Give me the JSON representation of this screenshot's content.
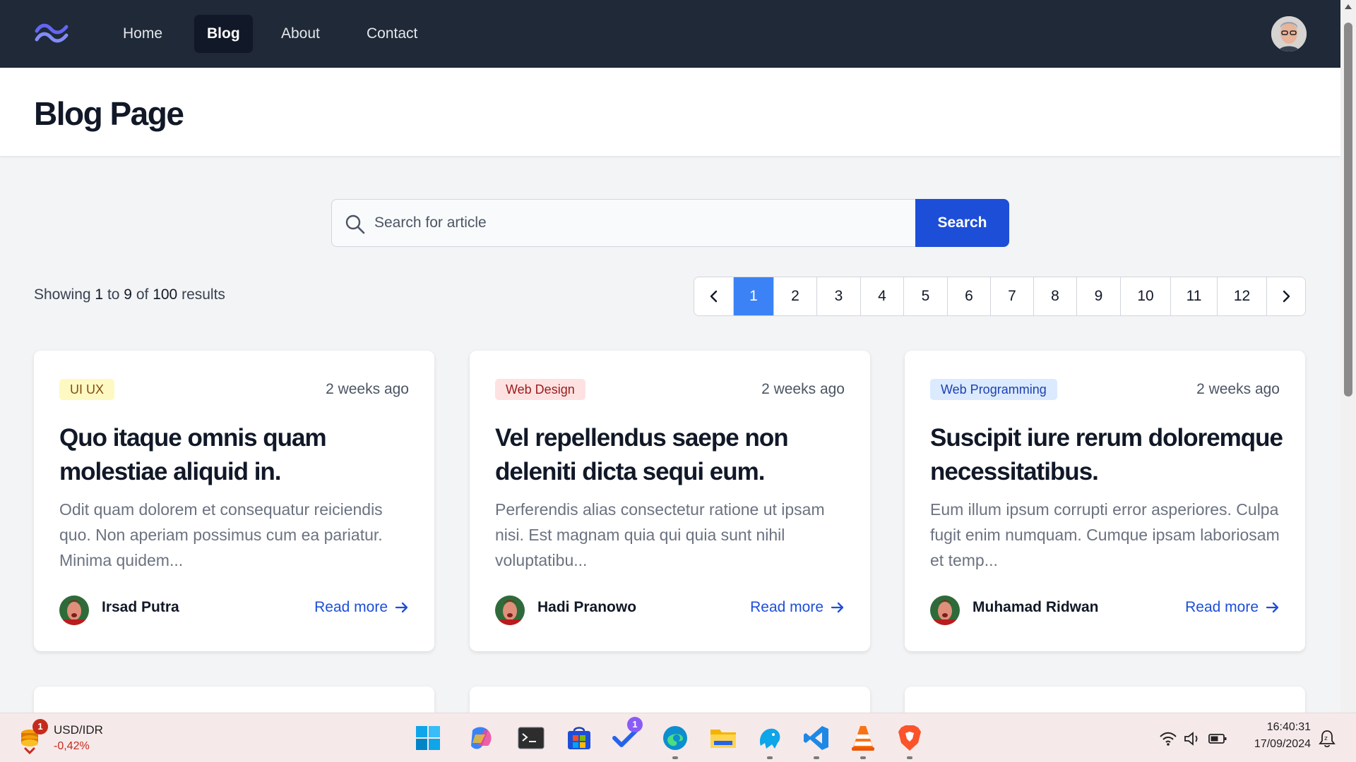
{
  "nav": {
    "items": [
      {
        "label": "Home"
      },
      {
        "label": "Blog"
      },
      {
        "label": "About"
      },
      {
        "label": "Contact"
      }
    ],
    "active_item": "Blog",
    "brand_color": "#1f2937"
  },
  "header": {
    "title": "Blog Page"
  },
  "search": {
    "placeholder": "Search for article",
    "value": "",
    "button_label": "Search",
    "button_color": "#1d4ed8"
  },
  "results": {
    "prefix": "Showing",
    "from": "1",
    "to_word": "to",
    "to": "9",
    "of_word": "of",
    "total": "100",
    "suffix": "results"
  },
  "pagination": {
    "prev_icon": "chevron-left-icon",
    "next_icon": "chevron-right-icon",
    "pages": [
      "1",
      "2",
      "3",
      "4",
      "5",
      "6",
      "7",
      "8",
      "9",
      "10",
      "11",
      "12"
    ],
    "current": "1",
    "active_color": "#3b82f6"
  },
  "cards": [
    {
      "category": "UI UX",
      "category_color": "yellow",
      "date": "2 weeks ago",
      "title": "Quo itaque omnis quam molestiae aliquid in.",
      "excerpt": "Odit quam dolorem et consequatur reiciendis quo. Non aperiam possimus cum ea pariatur. Minima quidem...",
      "author": "Irsad Putra",
      "read_more": "Read more"
    },
    {
      "category": "Web Design",
      "category_color": "red",
      "date": "2 weeks ago",
      "title": "Vel repellendus saepe non deleniti dicta sequi eum.",
      "excerpt": "Perferendis alias consectetur ratione ut ipsam nisi. Est magnam quia qui quia sunt nihil voluptatibu...",
      "author": "Hadi Pranowo",
      "read_more": "Read more"
    },
    {
      "category": "Web Programming",
      "category_color": "blue",
      "date": "2 weeks ago",
      "title": "Suscipit iure rerum doloremque necessitatibus.",
      "excerpt": "Eum illum ipsum corrupti error asperiores. Culpa fugit enim numquam. Cumque ipsam laboriosam et temp...",
      "author": "Muhamad Ridwan",
      "read_more": "Read more"
    }
  ],
  "taskbar": {
    "widget": {
      "title": "USD/IDR",
      "value": "-0,42%",
      "badge": "1"
    },
    "apps": [
      "windows-start-icon",
      "copilot-icon",
      "terminal-icon",
      "store-icon",
      "todo-icon",
      "edge-icon",
      "file-explorer-icon",
      "mysql-workbench-icon",
      "vscode-icon",
      "vlc-icon",
      "brave-icon"
    ],
    "todo_badge": "1",
    "clock": {
      "time": "16:40:31",
      "date": "17/09/2024"
    }
  }
}
